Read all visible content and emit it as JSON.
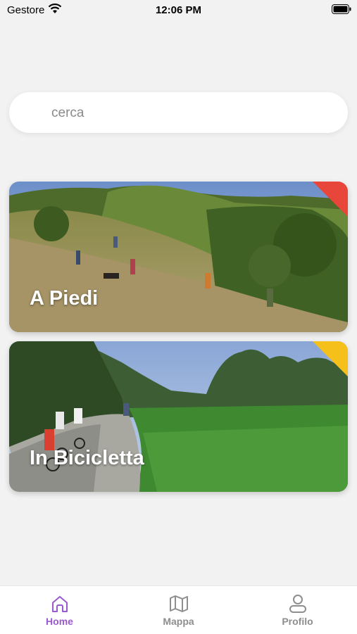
{
  "status_bar": {
    "carrier": "Gestore",
    "time": "12:06 PM"
  },
  "search": {
    "placeholder": "cerca"
  },
  "cards": [
    {
      "label": "A Piedi",
      "corner_color": "#e8463b"
    },
    {
      "label": "In Bicicletta",
      "corner_color": "#f5c01a"
    }
  ],
  "tabbar": {
    "active_color": "#9b59d0",
    "inactive_color": "#8e8e8e",
    "items": [
      {
        "label": "Home",
        "icon": "home-icon",
        "active": true
      },
      {
        "label": "Mappa",
        "icon": "map-icon",
        "active": false
      },
      {
        "label": "Profilo",
        "icon": "person-icon",
        "active": false
      }
    ]
  }
}
